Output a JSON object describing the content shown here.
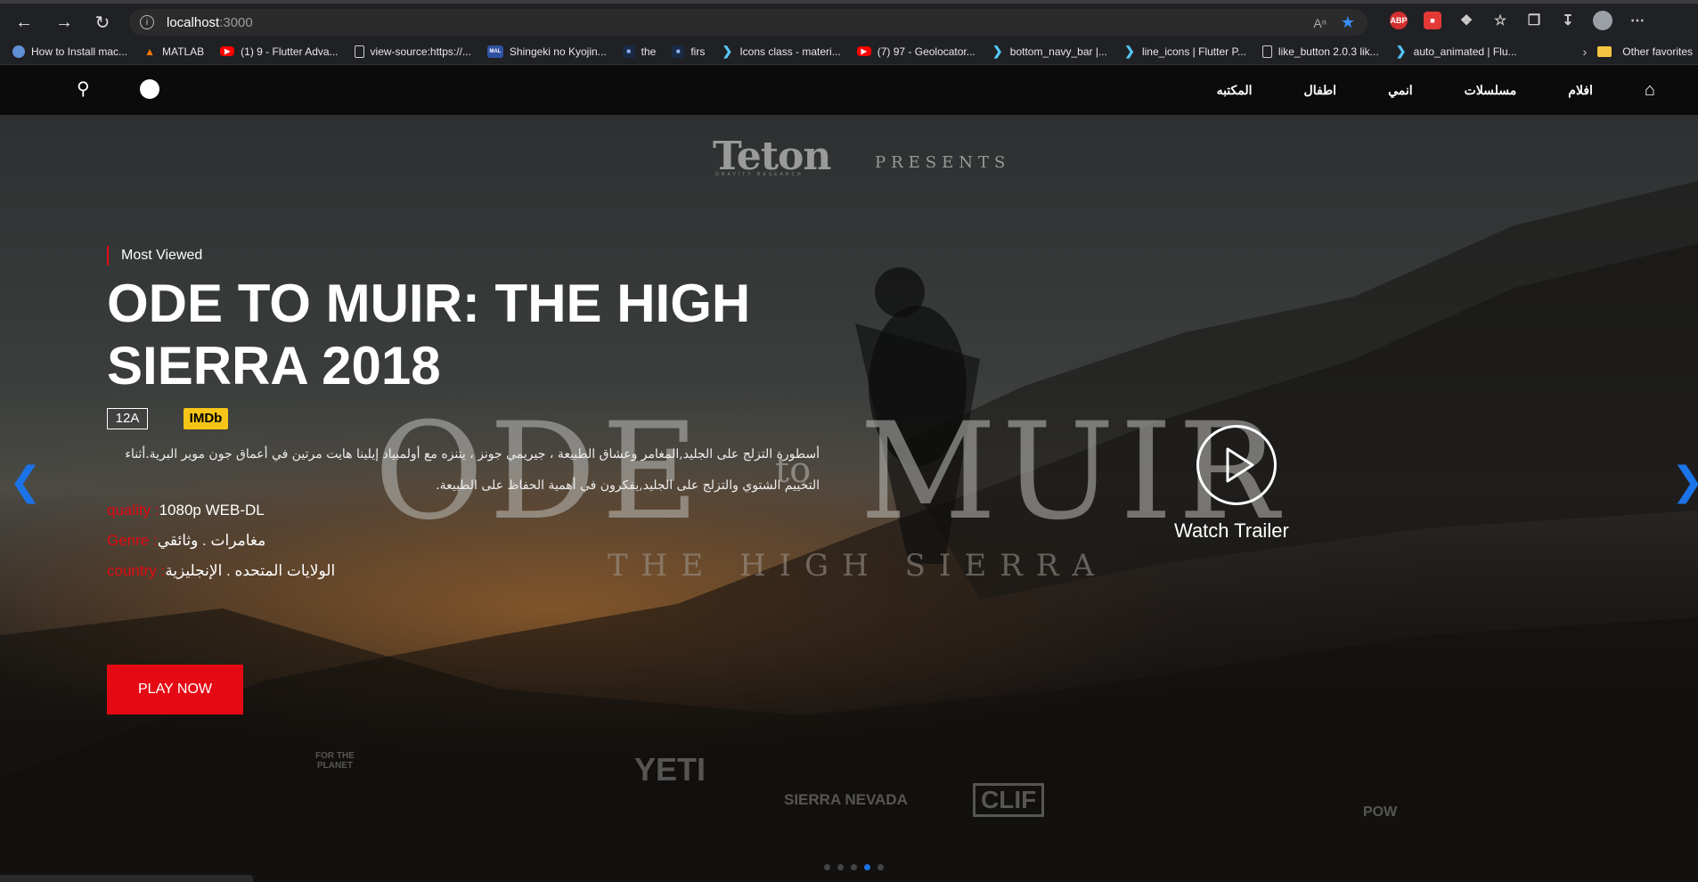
{
  "browser": {
    "url_host": "localhost",
    "url_port": ":3000",
    "bookmarks": [
      {
        "label": "How to Install mac...",
        "icon": "globe-icon"
      },
      {
        "label": "MATLAB",
        "icon": "matlab-icon"
      },
      {
        "label": "(1) 9 - Flutter Adva...",
        "icon": "youtube-icon"
      },
      {
        "label": "view-source:https://...",
        "icon": "page-icon"
      },
      {
        "label": "Shingeki no Kyojin...",
        "icon": "mal-icon"
      },
      {
        "label": "the",
        "icon": "bookmark-site-icon"
      },
      {
        "label": "firs",
        "icon": "bookmark-site-icon"
      },
      {
        "label": "Icons class - materi...",
        "icon": "flutter-icon"
      },
      {
        "label": "(7) 97 - Geolocator...",
        "icon": "youtube-icon"
      },
      {
        "label": "bottom_navy_bar |...",
        "icon": "flutter-icon"
      },
      {
        "label": "line_icons | Flutter P...",
        "icon": "flutter-icon"
      },
      {
        "label": "like_button 2.0.3 lik...",
        "icon": "page-icon"
      },
      {
        "label": "auto_animated | Flu...",
        "icon": "flutter-icon"
      }
    ],
    "other_favorites": "Other favorites",
    "ext_abp": "ABP"
  },
  "nav": {
    "links": [
      "المكتبه",
      "اطفال",
      "انمي",
      "مسلسلات",
      "افلام"
    ]
  },
  "hero": {
    "brand": "Teton",
    "brand_sub": "GRAVITY RESEARCH",
    "presents": "PRESENTS",
    "poster_ode": "ODE",
    "poster_to": "to",
    "poster_muir": "MUIR",
    "poster_sub": "THE HIGH SIERRA",
    "tag": "Most Viewed",
    "title": "ODE TO MUIR: THE HIGH SIERRA 2018",
    "rating": "12A",
    "imdb": "IMDb",
    "description": "أسطورة التزلج على الجليد,المغامر وعشاق الطبيعة ، جيريمي جونز ، يتنزه مع أولمبياد إيلينا هايت مرتين في أعماق جون موير البرية.أثناء التخييم الشتوي والتزلج على الجليد,يفكرون في أهمية الحفاظ على الطبيعة.",
    "quality_label": "quality :",
    "quality_value": "1080p WEB-DL",
    "genre_label": "Genre :",
    "genre_value": "مغامرات . وثائقي",
    "country_label": "country :",
    "country_value": "الولايات المتحده . الإنجليزية",
    "play_label": "PLAY NOW",
    "trailer_label": "Watch Trailer",
    "sponsors": [
      "FOR THE PLANET",
      "YETI",
      "SIERRA NEVADA",
      "CLIF",
      "POW"
    ]
  },
  "carousel": {
    "count": 5,
    "active": 3
  },
  "colors": {
    "accent": "#e50914",
    "imdb": "#f5c518",
    "arrow": "#1a73e8"
  }
}
